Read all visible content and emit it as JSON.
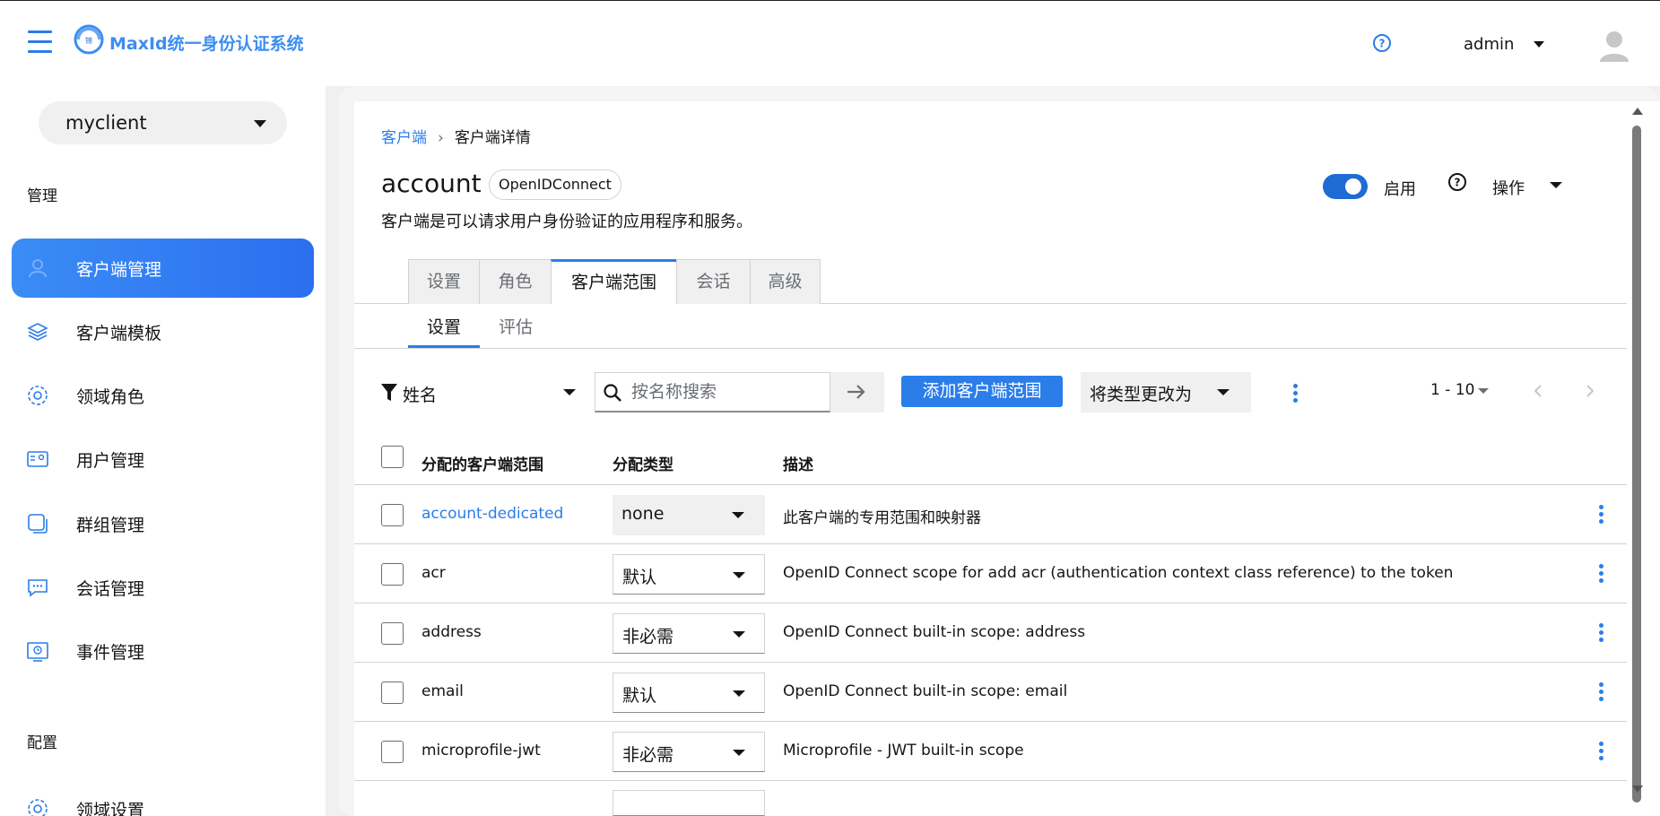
{
  "header": {
    "brand_text": "MaxId统一身份认证系统",
    "user_name": "admin"
  },
  "sidebar": {
    "realm_value": "myclient",
    "section_manage": "管理",
    "section_config": "配置",
    "items": [
      {
        "label": "客户端管理",
        "icon": "user-icon",
        "active": true
      },
      {
        "label": "客户端模板",
        "icon": "layers-icon",
        "active": false
      },
      {
        "label": "领域角色",
        "icon": "gear-icon",
        "active": false
      },
      {
        "label": "用户管理",
        "icon": "id-card-icon",
        "active": false
      },
      {
        "label": "群组管理",
        "icon": "group-icon",
        "active": false
      },
      {
        "label": "会话管理",
        "icon": "chat-icon",
        "active": false
      },
      {
        "label": "事件管理",
        "icon": "event-icon",
        "active": false
      },
      {
        "label": "领域设置",
        "icon": "gear-icon",
        "active": false
      }
    ]
  },
  "breadcrumb": {
    "link": "客户端",
    "current": "客户端详情"
  },
  "page": {
    "title": "account",
    "protocol": "OpenIDConnect",
    "description": "客户端是可以请求用户身份验证的应用程序和服务。",
    "enabled_label": "启用",
    "enabled": true,
    "action_label": "操作"
  },
  "tabs": [
    "设置",
    "角色",
    "客户端范围",
    "会话",
    "高级"
  ],
  "active_tab": "客户端范围",
  "subtabs": [
    "设置",
    "评估"
  ],
  "active_subtab": "设置",
  "toolbar": {
    "filter_label": "姓名",
    "search_placeholder": "按名称搜索",
    "add_button": "添加客户端范围",
    "change_type": "将类型更改为",
    "pagination": "1 - 10"
  },
  "table": {
    "columns": [
      "分配的客户端范围",
      "分配类型",
      "描述"
    ],
    "rows": [
      {
        "name": "account-dedicated",
        "type": "none",
        "desc": "此客户端的专用范围和映射器",
        "link": true
      },
      {
        "name": "acr",
        "type": "默认",
        "desc": "OpenID Connect scope for add acr (authentication context class reference) to the token",
        "link": false
      },
      {
        "name": "address",
        "type": "非必需",
        "desc": "OpenID Connect built-in scope: address",
        "link": false
      },
      {
        "name": "email",
        "type": "默认",
        "desc": "OpenID Connect built-in scope: email",
        "link": false
      },
      {
        "name": "microprofile-jwt",
        "type": "非必需",
        "desc": "Microprofile - JWT built-in scope",
        "link": false
      }
    ]
  },
  "colors": {
    "accent": "#2b7de9",
    "active_nav_start": "#3b8cf5",
    "active_nav_end": "#2b6ff0",
    "toggle_on": "#1f6bd5"
  }
}
